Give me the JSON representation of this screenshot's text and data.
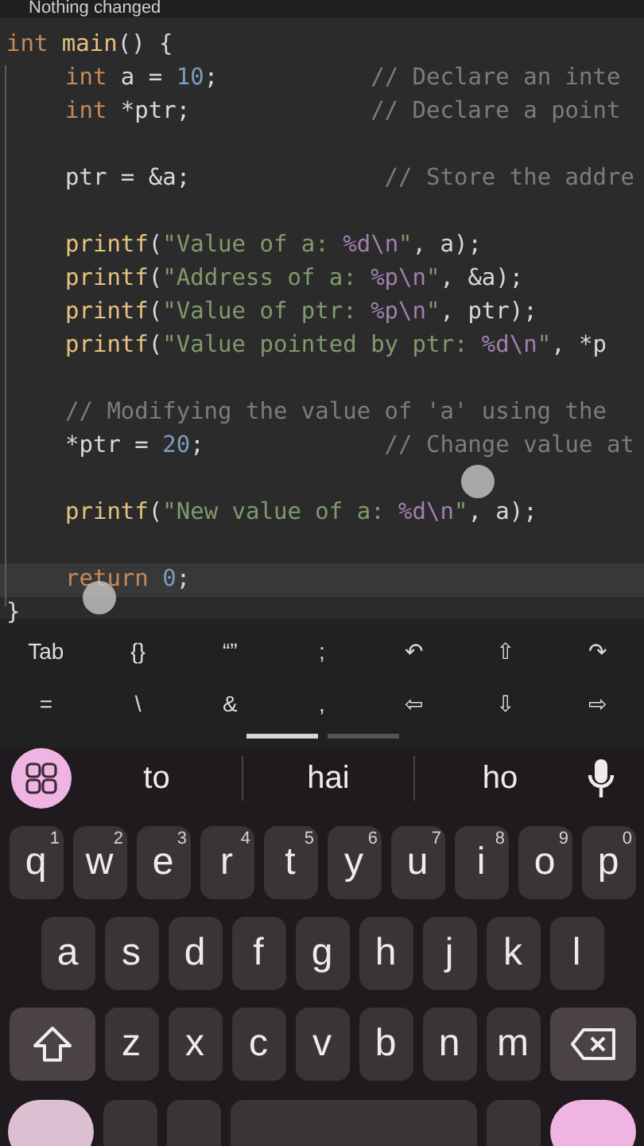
{
  "notice": "Nothing changed",
  "code_lines": [
    {
      "kind": "code",
      "indented": false,
      "current": false,
      "tokens": [
        {
          "kind": "keyword",
          "text": "int"
        },
        {
          "kind": "function",
          "text": " main"
        },
        {
          "kind": "plain",
          "text": "() {"
        }
      ]
    },
    {
      "kind": "code",
      "indented": true,
      "current": false,
      "tokens": [
        {
          "kind": "keyword",
          "text": "int"
        },
        {
          "kind": "plain",
          "text": " a = "
        },
        {
          "kind": "number",
          "text": "10"
        },
        {
          "kind": "plain",
          "text": ";           "
        },
        {
          "kind": "comment",
          "text": "// Declare an inte"
        }
      ]
    },
    {
      "kind": "code",
      "indented": true,
      "current": false,
      "tokens": [
        {
          "kind": "keyword",
          "text": "int"
        },
        {
          "kind": "plain",
          "text": " *ptr;             "
        },
        {
          "kind": "comment",
          "text": "// Declare a point"
        }
      ]
    },
    {
      "kind": "blank"
    },
    {
      "kind": "code",
      "indented": true,
      "current": false,
      "tokens": [
        {
          "kind": "plain",
          "text": "ptr = &a;              "
        },
        {
          "kind": "comment",
          "text": "// Store the addre"
        }
      ]
    },
    {
      "kind": "blank"
    },
    {
      "kind": "code",
      "indented": true,
      "current": false,
      "tokens": [
        {
          "kind": "function",
          "text": "printf"
        },
        {
          "kind": "plain",
          "text": "("
        },
        {
          "kind": "string",
          "text": "\"Value of a: "
        },
        {
          "kind": "format",
          "text": "%d\\n"
        },
        {
          "kind": "string",
          "text": "\""
        },
        {
          "kind": "plain",
          "text": ", a);"
        }
      ]
    },
    {
      "kind": "code",
      "indented": true,
      "current": false,
      "tokens": [
        {
          "kind": "function",
          "text": "printf"
        },
        {
          "kind": "plain",
          "text": "("
        },
        {
          "kind": "string",
          "text": "\"Address of a: "
        },
        {
          "kind": "format",
          "text": "%p\\n"
        },
        {
          "kind": "string",
          "text": "\""
        },
        {
          "kind": "plain",
          "text": ", &a);"
        }
      ]
    },
    {
      "kind": "code",
      "indented": true,
      "current": false,
      "tokens": [
        {
          "kind": "function",
          "text": "printf"
        },
        {
          "kind": "plain",
          "text": "("
        },
        {
          "kind": "string",
          "text": "\"Value of ptr: "
        },
        {
          "kind": "format",
          "text": "%p\\n"
        },
        {
          "kind": "string",
          "text": "\""
        },
        {
          "kind": "plain",
          "text": ", ptr);"
        }
      ]
    },
    {
      "kind": "code",
      "indented": true,
      "current": false,
      "tokens": [
        {
          "kind": "function",
          "text": "printf"
        },
        {
          "kind": "plain",
          "text": "("
        },
        {
          "kind": "string",
          "text": "\"Value pointed by ptr: "
        },
        {
          "kind": "format",
          "text": "%d\\n"
        },
        {
          "kind": "string",
          "text": "\""
        },
        {
          "kind": "plain",
          "text": ", *p"
        }
      ]
    },
    {
      "kind": "blank"
    },
    {
      "kind": "code",
      "indented": true,
      "current": false,
      "tokens": [
        {
          "kind": "comment",
          "text": "// Modifying the value of 'a' using the"
        }
      ]
    },
    {
      "kind": "code",
      "indented": true,
      "current": false,
      "tokens": [
        {
          "kind": "plain",
          "text": "*ptr = "
        },
        {
          "kind": "number",
          "text": "20"
        },
        {
          "kind": "plain",
          "text": ";             "
        },
        {
          "kind": "comment",
          "text": "// Change value at"
        }
      ]
    },
    {
      "kind": "blank"
    },
    {
      "kind": "code",
      "indented": true,
      "current": false,
      "tokens": [
        {
          "kind": "function",
          "text": "printf"
        },
        {
          "kind": "plain",
          "text": "("
        },
        {
          "kind": "string",
          "text": "\"New value of a: "
        },
        {
          "kind": "format",
          "text": "%d\\n"
        },
        {
          "kind": "string",
          "text": "\""
        },
        {
          "kind": "plain",
          "text": ", a);"
        }
      ]
    },
    {
      "kind": "blank"
    },
    {
      "kind": "code",
      "indented": true,
      "current": true,
      "tokens": [
        {
          "kind": "keyword",
          "text": "return"
        },
        {
          "kind": "number",
          "text": " 0"
        },
        {
          "kind": "plain",
          "text": ";"
        }
      ]
    },
    {
      "kind": "code",
      "indented": false,
      "current": false,
      "tokens": [
        {
          "kind": "plain",
          "text": "}"
        }
      ]
    }
  ],
  "extra_keys": [
    [
      "Tab",
      "{}",
      "“”",
      ";",
      "↶",
      "⇧",
      "↷"
    ],
    [
      "=",
      "\\",
      "&",
      ",",
      "⇦",
      "⇩",
      "⇨"
    ]
  ],
  "pages": [
    {
      "selected": true
    },
    {
      "selected": false
    }
  ],
  "suggestions": [
    "to",
    "hai",
    "ho"
  ],
  "key_rows": [
    [
      {
        "kind": "letter",
        "label": "q",
        "hint": "1"
      },
      {
        "kind": "letter",
        "label": "w",
        "hint": "2"
      },
      {
        "kind": "letter",
        "label": "e",
        "hint": "3"
      },
      {
        "kind": "letter",
        "label": "r",
        "hint": "4"
      },
      {
        "kind": "letter",
        "label": "t",
        "hint": "5"
      },
      {
        "kind": "letter",
        "label": "y",
        "hint": "6"
      },
      {
        "kind": "letter",
        "label": "u",
        "hint": "7"
      },
      {
        "kind": "letter",
        "label": "i",
        "hint": "8"
      },
      {
        "kind": "letter",
        "label": "o",
        "hint": "9"
      },
      {
        "kind": "letter",
        "label": "p",
        "hint": "0"
      }
    ],
    [
      {
        "kind": "letter",
        "label": "a"
      },
      {
        "kind": "letter",
        "label": "s"
      },
      {
        "kind": "letter",
        "label": "d"
      },
      {
        "kind": "letter",
        "label": "f"
      },
      {
        "kind": "letter",
        "label": "g"
      },
      {
        "kind": "letter",
        "label": "h"
      },
      {
        "kind": "letter",
        "label": "j"
      },
      {
        "kind": "letter",
        "label": "k"
      },
      {
        "kind": "letter",
        "label": "l"
      }
    ],
    [
      {
        "kind": "shift"
      },
      {
        "kind": "letter",
        "label": "z"
      },
      {
        "kind": "letter",
        "label": "x"
      },
      {
        "kind": "letter",
        "label": "c"
      },
      {
        "kind": "letter",
        "label": "v"
      },
      {
        "kind": "letter",
        "label": "b"
      },
      {
        "kind": "letter",
        "label": "n"
      },
      {
        "kind": "letter",
        "label": "m"
      },
      {
        "kind": "backspace"
      }
    ]
  ]
}
